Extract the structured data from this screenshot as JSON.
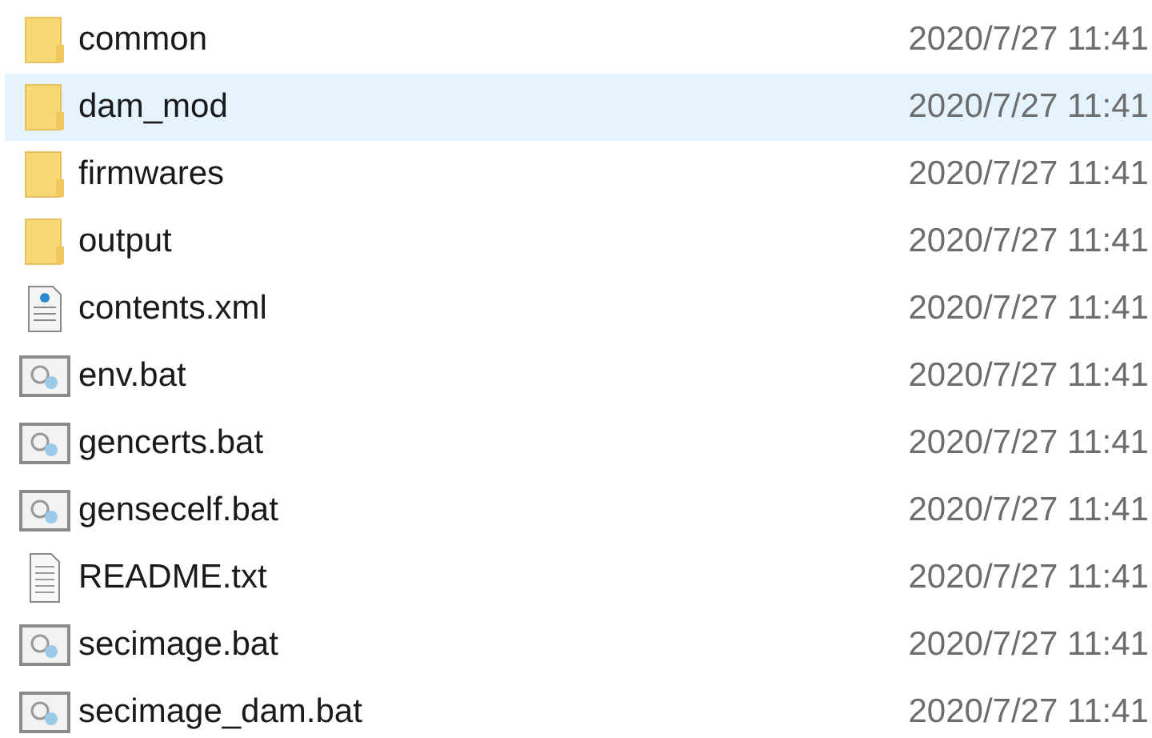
{
  "files": [
    {
      "name": "common",
      "kind": "folder",
      "date": "2020/7/27 11:41",
      "selected": false
    },
    {
      "name": "dam_mod",
      "kind": "folder",
      "date": "2020/7/27 11:41",
      "selected": true
    },
    {
      "name": "firmwares",
      "kind": "folder",
      "date": "2020/7/27 11:41",
      "selected": false
    },
    {
      "name": "output",
      "kind": "folder",
      "date": "2020/7/27 11:41",
      "selected": false
    },
    {
      "name": "contents.xml",
      "kind": "xml",
      "date": "2020/7/27 11:41",
      "selected": false
    },
    {
      "name": "env.bat",
      "kind": "bat",
      "date": "2020/7/27 11:41",
      "selected": false
    },
    {
      "name": "gencerts.bat",
      "kind": "bat",
      "date": "2020/7/27 11:41",
      "selected": false
    },
    {
      "name": "gensecelf.bat",
      "kind": "bat",
      "date": "2020/7/27 11:41",
      "selected": false
    },
    {
      "name": "README.txt",
      "kind": "txt",
      "date": "2020/7/27 11:41",
      "selected": false
    },
    {
      "name": "secimage.bat",
      "kind": "bat",
      "date": "2020/7/27 11:41",
      "selected": false
    },
    {
      "name": "secimage_dam.bat",
      "kind": "bat",
      "date": "2020/7/27 11:41",
      "selected": false
    }
  ]
}
